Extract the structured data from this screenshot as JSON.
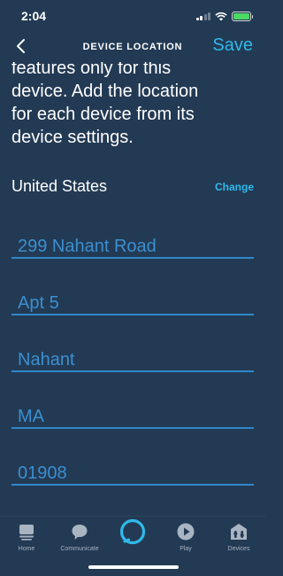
{
  "status_bar": {
    "time": "2:04"
  },
  "header": {
    "title": "DEVICE LOCATION",
    "save_label": "Save",
    "back_icon": "chevron-left-icon"
  },
  "description": {
    "lines": [
      "features only for this",
      "device. Add the location",
      "for each device from its",
      "device settings."
    ]
  },
  "country": {
    "name": "United States",
    "change_label": "Change"
  },
  "address_fields": [
    {
      "name": "street",
      "value": "299 Nahant Road"
    },
    {
      "name": "apt",
      "value": "Apt 5"
    },
    {
      "name": "city",
      "value": "Nahant"
    },
    {
      "name": "state",
      "value": "MA"
    },
    {
      "name": "zip",
      "value": "01908"
    }
  ],
  "tab_bar": {
    "tabs": [
      {
        "label": "Home",
        "icon": "home-icon"
      },
      {
        "label": "Communicate",
        "icon": "chat-bubble-icon"
      },
      {
        "label": "",
        "icon": "alexa-ring-icon"
      },
      {
        "label": "Play",
        "icon": "play-icon"
      },
      {
        "label": "Devices",
        "icon": "devices-icon"
      }
    ]
  },
  "colors": {
    "background": "#233a54",
    "accent": "#2fb9ea",
    "field_text": "#3b8fd0",
    "field_underline": "#2f87c7",
    "tab_label": "#a8b4c2"
  }
}
